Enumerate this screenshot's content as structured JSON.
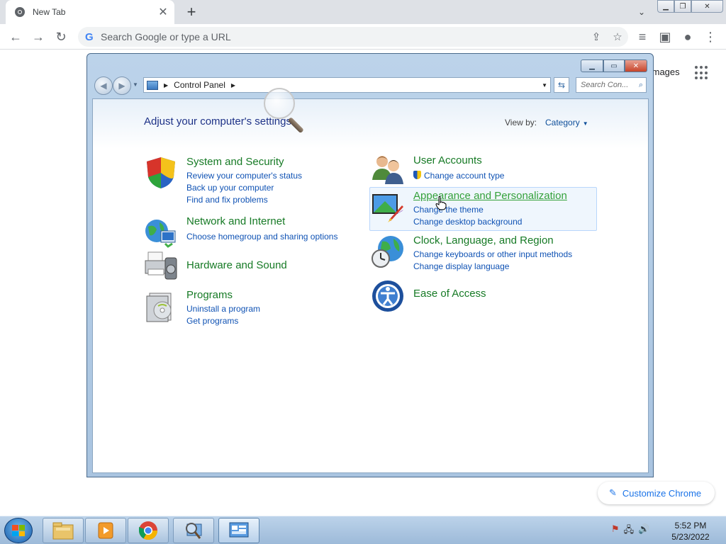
{
  "browser": {
    "tab_title": "New Tab",
    "omnibox_placeholder": "Search Google or type a URL",
    "ntp_images_text": "Images",
    "customize_label": "Customize Chrome"
  },
  "control_panel": {
    "breadcrumb": [
      "Control Panel"
    ],
    "search_placeholder": "Search Con...",
    "heading": "Adjust your computer's settings",
    "view_by_label": "View by:",
    "view_by_value": "Category",
    "categories_left": [
      {
        "title": "System and Security",
        "links": [
          "Review your computer's status",
          "Back up your computer",
          "Find and fix problems"
        ]
      },
      {
        "title": "Network and Internet",
        "links": [
          "Choose homegroup and sharing options"
        ]
      },
      {
        "title": "Hardware and Sound",
        "links": []
      },
      {
        "title": "Programs",
        "links": [
          "Uninstall a program",
          "Get programs"
        ]
      }
    ],
    "categories_right": [
      {
        "title": "User Accounts",
        "links": [
          "Change account type"
        ]
      },
      {
        "title": "Appearance and Personalization",
        "links": [
          "Change the theme",
          "Change desktop background"
        ]
      },
      {
        "title": "Clock, Language, and Region",
        "links": [
          "Change keyboards or other input methods",
          "Change display language"
        ]
      },
      {
        "title": "Ease of Access",
        "links": []
      }
    ]
  },
  "taskbar": {
    "time": "5:52 PM",
    "date": "5/23/2022"
  },
  "colors": {
    "category_title": "#167a25",
    "link": "#0f52b4",
    "heading": "#1e3287",
    "chrome_blue": "#1a73e8"
  }
}
